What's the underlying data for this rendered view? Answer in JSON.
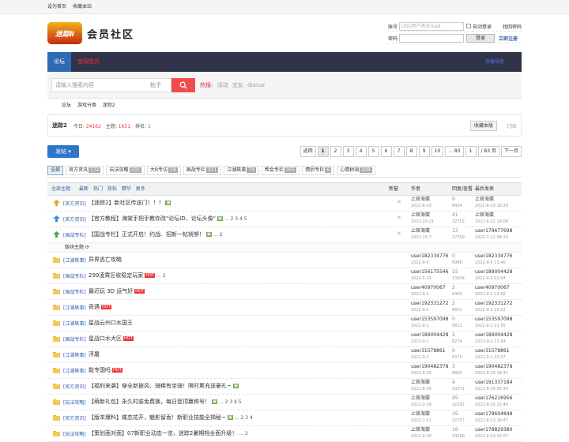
{
  "topbar": {
    "set_home": "设为首页",
    "bookmark": "收藏本站"
  },
  "logo": {
    "badge": "迷踪Ⅱ",
    "text": "会员社区"
  },
  "login": {
    "account_label": "账号",
    "account_placeholder": "UID/用户名/Email",
    "auto_login": "自动登录",
    "find_password": "找回密码",
    "password_label": "密码",
    "login_button": "登录",
    "register": "立即注册"
  },
  "nav": {
    "tabs": [
      "论坛",
      "官网首页"
    ],
    "right": "快捷导航"
  },
  "search": {
    "placeholder": "请输入搜索内容",
    "type": "帖子",
    "hot_label": "热搜:",
    "hot_terms": [
      "活动",
      "交友",
      "discuz"
    ]
  },
  "breadcrumb": [
    "论坛",
    "游戏分类",
    "迷踪2"
  ],
  "forum": {
    "title": "迷踪2",
    "today_label": "今日:",
    "today": "24162",
    "topics_label": "主题:",
    "topics": "1651",
    "rank_label": "排名:",
    "rank": "1",
    "fav_button": "收藏本版",
    "subscribe": "订阅"
  },
  "post_button": "发帖",
  "pager": [
    "返回",
    "1",
    "2",
    "3",
    "4",
    "5",
    "6",
    "7",
    "8",
    "9",
    "10",
    "... 83",
    "1",
    "/ 83 页",
    "下一页"
  ],
  "categories": [
    {
      "label": "全部",
      "n": ""
    },
    {
      "label": "官方资讯",
      "n": "172"
    },
    {
      "label": "玩法攻略",
      "n": "231"
    },
    {
      "label": "大R专访",
      "n": "18"
    },
    {
      "label": "国战专栏",
      "n": "411"
    },
    {
      "label": "江湖轶事",
      "n": "74"
    },
    {
      "label": "帮会专栏",
      "n": "355"
    },
    {
      "label": "情侣专栏",
      "n": "6"
    },
    {
      "label": "心情树洞",
      "n": "208"
    }
  ],
  "thead": {
    "all": "全部主题",
    "filters": [
      "最新",
      "热门",
      "热帖",
      "精华",
      "更多"
    ],
    "newer": "新窗",
    "author": "作者",
    "reply": "回复/查看",
    "last": "最后发表"
  },
  "sticky_label": "版块主题",
  "threads": [
    {
      "icon": "up",
      "tag": "[官方资讯]",
      "title": "【迷踪2】新社区传送门！！！",
      "pic": true,
      "hot": false,
      "pages": "",
      "author": "上官海棠",
      "date": "2022-8-29",
      "replies": "0",
      "views": "8404",
      "last": "上官海棠",
      "last_date": "2022-8-29 16:39",
      "close": true
    },
    {
      "icon": "up",
      "tag": "[官方资讯]",
      "title": "【官方教程】海棠手把手教你改\"论坛ID、论坛头像\"",
      "pic": true,
      "hot": false,
      "pages": "... 2 3 4 5",
      "author": "上官海棠",
      "date": "2021-10-21",
      "replies": "41",
      "views": "32752",
      "last": "上官海棠",
      "last_date": "2022-6-22 18:08",
      "close": true
    },
    {
      "icon": "up",
      "tag": "[国战专栏]",
      "title": "【国战专栏】正式开启！约战、招新一帖就够！",
      "pic": true,
      "hot": false,
      "pages": "... 2",
      "author": "上官海棠",
      "date": "2021-10-7",
      "replies": "13",
      "views": "12799",
      "last": "user179677698",
      "last_date": "2022-7-12 08:24",
      "close": true
    },
    {
      "icon": "f",
      "tag": "[江湖轶事]",
      "title": "异界逃亡攻略",
      "pic": false,
      "hot": false,
      "pages": "",
      "author": "user182334776",
      "date": "2022-9-5",
      "replies": "0",
      "views": "6988",
      "last": "user182334776",
      "last_date": "2022-9-5 13:40",
      "close": false
    },
    {
      "icon": "f",
      "tag": "[国战专栏]",
      "title": "299凌霄区收稳定玩家",
      "pic": false,
      "hot": true,
      "pages": "... 2",
      "author": "user156175546",
      "date": "2022-5-15",
      "replies": "15",
      "views": "13604",
      "last": "user189004428",
      "last_date": "2022-9-6 01:04",
      "close": false
    },
    {
      "icon": "f",
      "tag": "[国战专栏]",
      "title": "最近玩 3D 运气好",
      "pic": false,
      "hot": true,
      "pages": "",
      "author": "user40970067",
      "date": "2022-9-2",
      "replies": "2",
      "views": "6405",
      "last": "user40970067",
      "last_date": "2022-9-2 12:50",
      "close": false
    },
    {
      "icon": "f",
      "tag": "[江湖轶事]",
      "title": "奇遇",
      "pic": false,
      "hot": true,
      "pages": "",
      "author": "user192331272",
      "date": "2022-9-2",
      "replies": "2",
      "views": "6601",
      "last": "user192331272",
      "last_date": "2022-9-2 10:22",
      "close": false
    },
    {
      "icon": "f",
      "tag": "[江湖轶事]",
      "title": "星战云州口水国王",
      "pic": false,
      "hot": false,
      "pages": "",
      "author": "user153597098",
      "date": "2022-9-1",
      "replies": "0",
      "views": "5811",
      "last": "user153597098",
      "last_date": "2022-9-1 21:50",
      "close": false
    },
    {
      "icon": "f",
      "tag": "[国战专栏]",
      "title": "星战口水大区",
      "pic": false,
      "hot": true,
      "pages": "",
      "author": "user189004428",
      "date": "2022-9-1",
      "replies": "2",
      "views": "6274",
      "last": "user189004428",
      "last_date": "2022-9-1 21:54",
      "close": false
    },
    {
      "icon": "f",
      "tag": "[江湖轶事]",
      "title": "浮屠",
      "pic": false,
      "hot": false,
      "pages": "",
      "author": "user31578861",
      "date": "2022-9-1",
      "replies": "0",
      "views": "6375",
      "last": "user31578861",
      "last_date": "2022-9-1 20:27",
      "close": false
    },
    {
      "icon": "f",
      "tag": "[江湖轶事]",
      "title": "能专国吗",
      "pic": false,
      "hot": true,
      "pages": "",
      "author": "user190482378",
      "date": "2022-8-28",
      "replies": "3",
      "views": "6800",
      "last": "user190482378",
      "last_date": "2022-8-28 19:41",
      "close": false
    },
    {
      "icon": "f",
      "tag": "[官方资讯]",
      "title": "【福利来袭】穿全新披风、骑稀有坐骑！限时累充送豪礼~",
      "pic": true,
      "hot": false,
      "pages": "",
      "author": "上官海棠",
      "date": "2022-8-26",
      "replies": "4",
      "views": "10071",
      "last": "user191337184",
      "last_date": "2022-8-28 05:34",
      "close": false
    },
    {
      "icon": "f",
      "tag": "[玩法攻略]",
      "title": "【萌新礼包】永久时装免费换，每日登顶赢称号！",
      "pic": true,
      "hot": false,
      "pages": "... 2 3 4 5",
      "author": "上官海棠",
      "date": "2022-2-18",
      "replies": "45",
      "views": "32197",
      "last": "user176216956",
      "last_date": "2022-8-25 15:46",
      "close": false
    },
    {
      "icon": "f",
      "tag": "[官方资讯]",
      "title": "【版本爆料】蝶恋花开，魅影留香！新职业技能全揭秘~",
      "pic": true,
      "hot": false,
      "pages": "... 2 3 4",
      "author": "上官海棠",
      "date": "2022-7-21",
      "replies": "35",
      "views": "22757",
      "last": "user178604848",
      "last_date": "2022-8-23 18:47",
      "close": false
    },
    {
      "icon": "f",
      "tag": "[玩法攻略]",
      "title": "【策划面对面】07新职业动态一览，迷踪2暑期档全面升级！",
      "pic": false,
      "hot": false,
      "pages": "... 2",
      "author": "上官海棠",
      "date": "2022-6-30",
      "replies": "16",
      "views": "14599",
      "last": "user178829380",
      "last_date": "2022-8-23 00:07",
      "close": false
    }
  ]
}
